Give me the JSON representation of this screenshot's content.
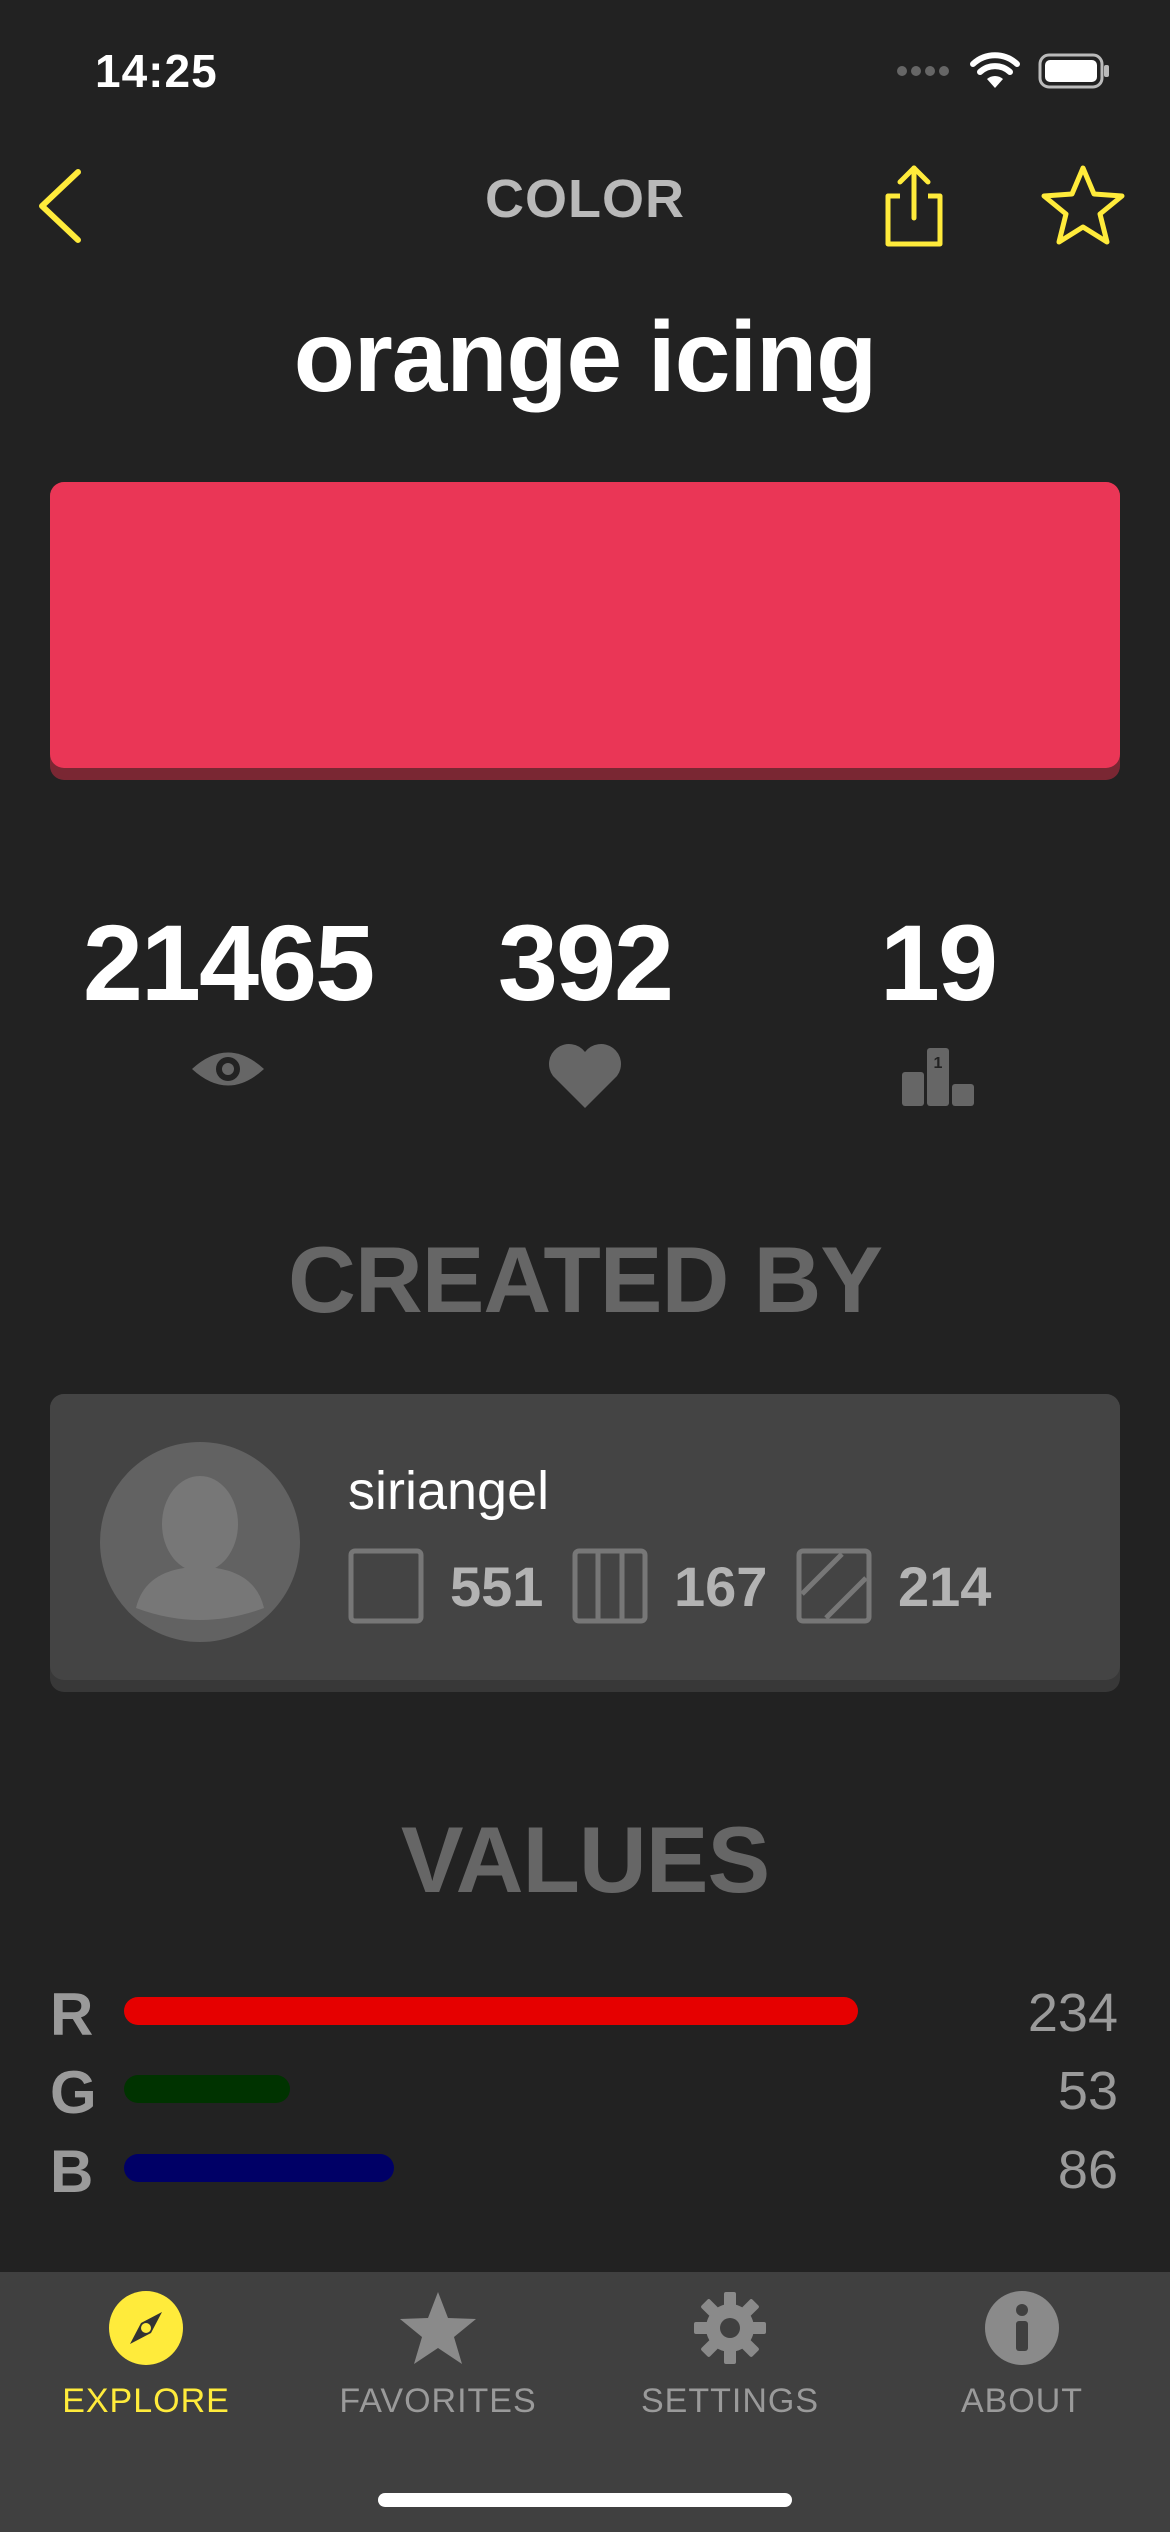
{
  "status_bar": {
    "time": "14:25"
  },
  "nav": {
    "title": "COLOR"
  },
  "color": {
    "name": "orange icing",
    "hex": "#EA3656",
    "stats": {
      "views": "21465",
      "likes": "392",
      "rank": "19"
    }
  },
  "creator": {
    "heading": "CREATED BY",
    "username": "siriangel",
    "colors_count": "551",
    "palettes_count": "167",
    "patterns_count": "214"
  },
  "values": {
    "heading": "VALUES",
    "channels": [
      {
        "label": "R",
        "value": "234",
        "fraction": 0.918,
        "color": "#E60000"
      },
      {
        "label": "G",
        "value": "53",
        "fraction": 0.208,
        "color": "#003300"
      },
      {
        "label": "B",
        "value": "86",
        "fraction": 0.337,
        "color": "#000066"
      }
    ]
  },
  "tabs": [
    {
      "label": "EXPLORE",
      "icon": "compass-icon",
      "active": true
    },
    {
      "label": "FAVORITES",
      "icon": "star-icon",
      "active": false
    },
    {
      "label": "SETTINGS",
      "icon": "gear-icon",
      "active": false
    },
    {
      "label": "ABOUT",
      "icon": "info-icon",
      "active": false
    }
  ],
  "theme": {
    "accent": "#FFEB3B",
    "background": "#222222",
    "inactive": "#9A9A9A"
  }
}
